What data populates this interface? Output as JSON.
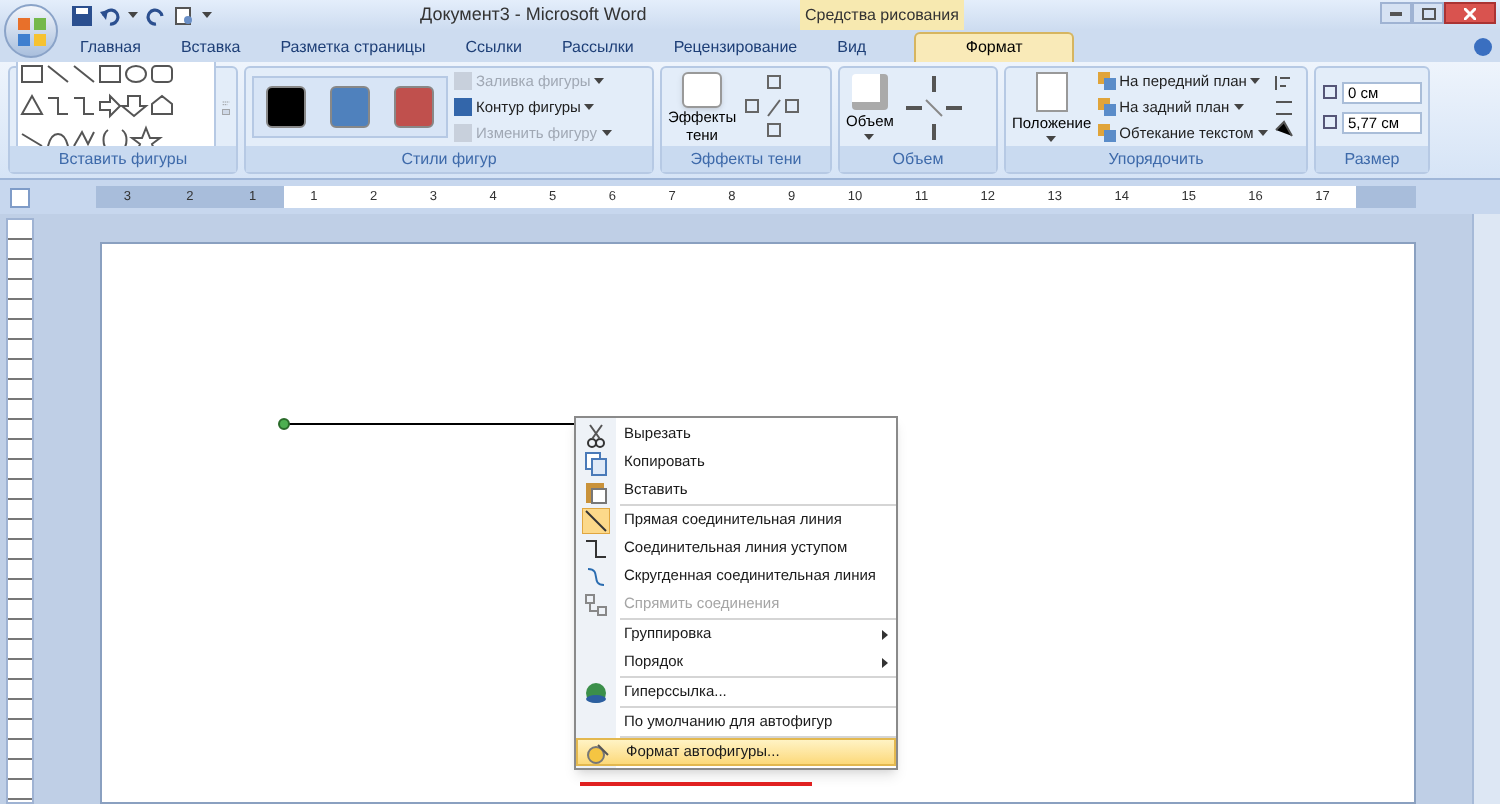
{
  "window": {
    "title": "Документ3 - Microsoft Word",
    "contextual_label": "Средства рисования"
  },
  "tabs": [
    {
      "label": "Главная",
      "selected": false,
      "contextual": false
    },
    {
      "label": "Вставка",
      "selected": false,
      "contextual": false
    },
    {
      "label": "Разметка страницы",
      "selected": false,
      "contextual": false
    },
    {
      "label": "Ссылки",
      "selected": false,
      "contextual": false
    },
    {
      "label": "Рассылки",
      "selected": false,
      "contextual": false
    },
    {
      "label": "Рецензирование",
      "selected": false,
      "contextual": false
    },
    {
      "label": "Вид",
      "selected": false,
      "contextual": false
    },
    {
      "label": "Формат",
      "selected": true,
      "contextual": true
    }
  ],
  "ribbon": {
    "insert_shapes": {
      "label": "Вставить фигуры"
    },
    "shape_styles": {
      "label": "Стили фигур",
      "swatches": [
        {
          "color": "#000000"
        },
        {
          "color": "#4f81bd"
        },
        {
          "color": "#c0504d"
        }
      ],
      "commands": [
        {
          "label": "Заливка фигуры",
          "disabled": true
        },
        {
          "label": "Контур фигуры",
          "disabled": false
        },
        {
          "label": "Изменить фигуру",
          "disabled": true
        }
      ]
    },
    "shadow": {
      "label": "Эффекты тени",
      "button_line1": "Эффекты",
      "button_line2": "тени"
    },
    "volume": {
      "label": "Объем",
      "button": "Объем"
    },
    "arrange": {
      "label": "Упорядочить",
      "position_button": "Положение",
      "commands": [
        "На передний план",
        "На задний план",
        "Обтекание текстом"
      ]
    },
    "size": {
      "label": "Размер",
      "height": "0 см",
      "width": "5,77 см"
    }
  },
  "ruler": {
    "left_numbers": [
      "3",
      "2",
      "1"
    ],
    "numbers": [
      "1",
      "2",
      "3",
      "4",
      "5",
      "6",
      "7",
      "8",
      "9",
      "10",
      "11",
      "12",
      "13",
      "14",
      "15",
      "16",
      "17"
    ]
  },
  "context_menu": {
    "sections": [
      {
        "items": [
          {
            "label": "Вырезать",
            "disabled": false,
            "submenu": false,
            "selected": false
          },
          {
            "label": "Копировать",
            "disabled": false,
            "submenu": false,
            "selected": false
          },
          {
            "label": "Вставить",
            "disabled": false,
            "submenu": false,
            "selected": false
          }
        ]
      },
      {
        "items": [
          {
            "label": "Прямая соединительная линия",
            "disabled": false,
            "submenu": false,
            "selected": false,
            "checked": true
          },
          {
            "label": "Соединительная линия уступом",
            "disabled": false,
            "submenu": false,
            "selected": false,
            "checked": false
          },
          {
            "label": "Скругденная соединительная линия",
            "disabled": false,
            "submenu": false,
            "selected": false,
            "checked": false
          },
          {
            "label": "Спрямить соединения",
            "disabled": true,
            "submenu": false,
            "selected": false
          }
        ]
      },
      {
        "items": [
          {
            "label": "Группировка",
            "disabled": false,
            "submenu": true,
            "selected": false
          },
          {
            "label": "Порядок",
            "disabled": false,
            "submenu": true,
            "selected": false
          }
        ]
      },
      {
        "items": [
          {
            "label": "Гиперссылка...",
            "disabled": false,
            "submenu": false,
            "selected": false
          }
        ]
      },
      {
        "items": [
          {
            "label": "По умолчанию для автофигур",
            "disabled": false,
            "submenu": false,
            "selected": false
          }
        ]
      },
      {
        "items": [
          {
            "label": "Формат автофигуры...",
            "disabled": false,
            "submenu": false,
            "selected": true
          }
        ]
      }
    ]
  }
}
